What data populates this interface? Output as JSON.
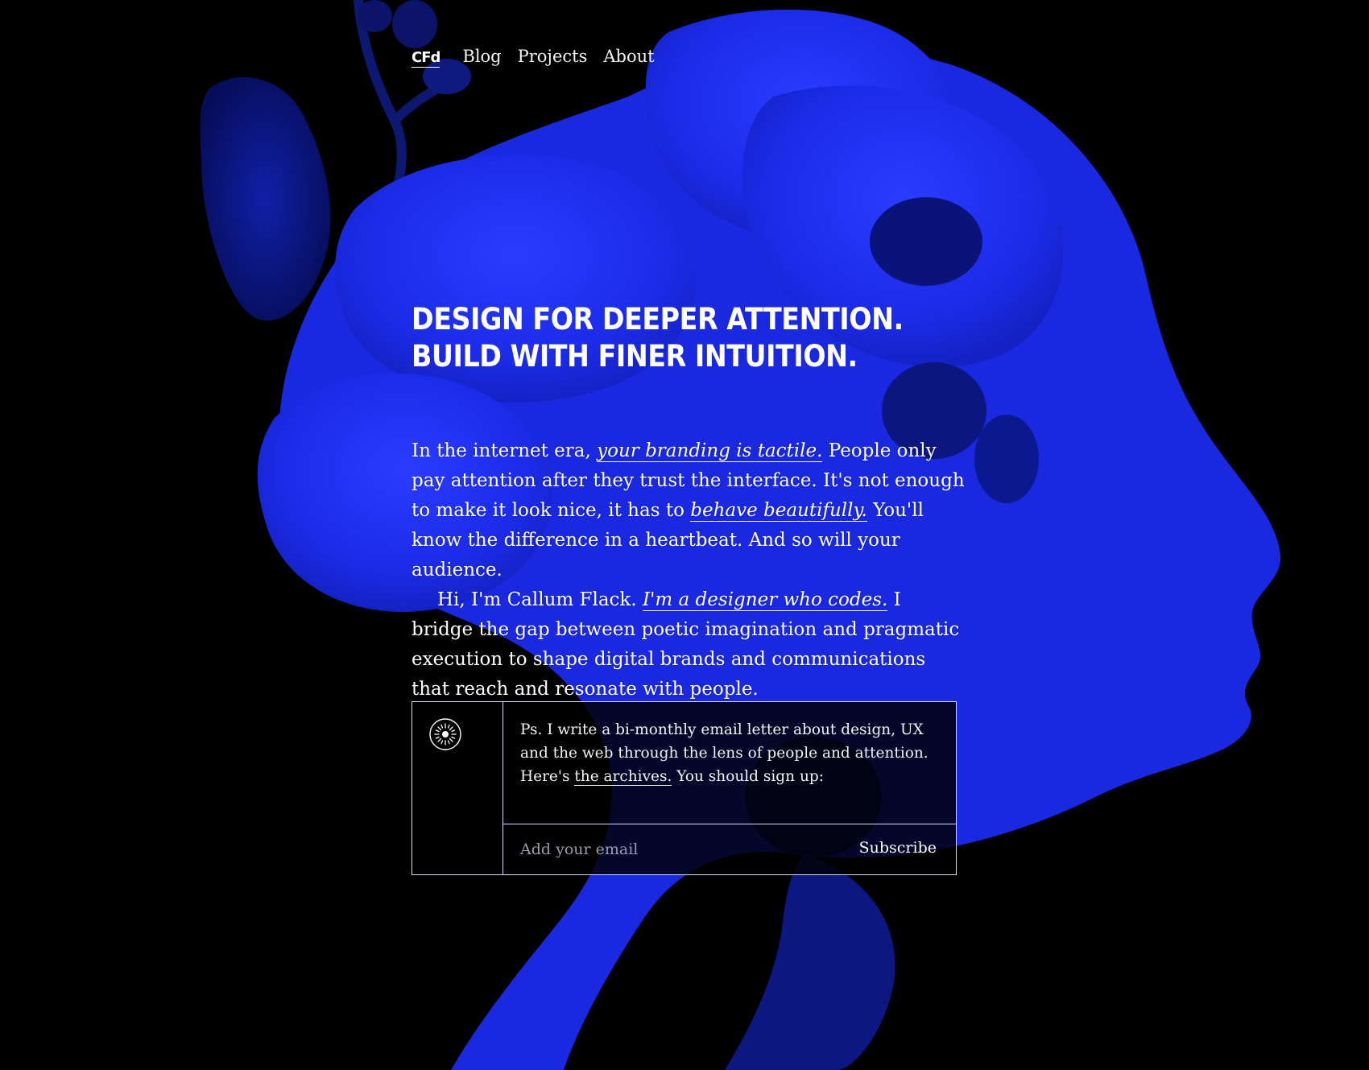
{
  "nav": {
    "logo": "CFd",
    "items": [
      {
        "label": "Blog"
      },
      {
        "label": "Projects"
      },
      {
        "label": "About"
      }
    ]
  },
  "hero": {
    "headline_line1": "DESIGN FOR DEEPER ATTENTION.",
    "headline_line2": "BUILD WITH FINER INTUITION."
  },
  "intro": {
    "p1_a": "In the internet era, ",
    "p1_link1": "your branding is tactile.",
    "p1_b": " People only pay attention after they trust the interface. It's not enough to make it look nice, it has to ",
    "p1_link2": "behave beautifully.",
    "p1_c": " You'll know the difference in a heartbeat. And so will your audience.",
    "p2_a": "Hi, I'm Callum Flack. ",
    "p2_link": "I'm a designer who codes.",
    "p2_b": " I bridge the gap between poetic imagination and pragmatic execution to shape digital brands and communications that reach and resonate with people."
  },
  "newsletter": {
    "icon": "sun-burst-icon",
    "text_a": "Ps. I write a bi-monthly email letter about design, UX and the web through the lens of people and attention. Here's ",
    "archives_link": "the archives.",
    "text_b": " You should sign up:",
    "email_placeholder": "Add your email",
    "subscribe_label": "Subscribe"
  },
  "colors": {
    "background": "#000000",
    "accent_blue": "#1f2ef0",
    "text": "#f2f2f2"
  }
}
